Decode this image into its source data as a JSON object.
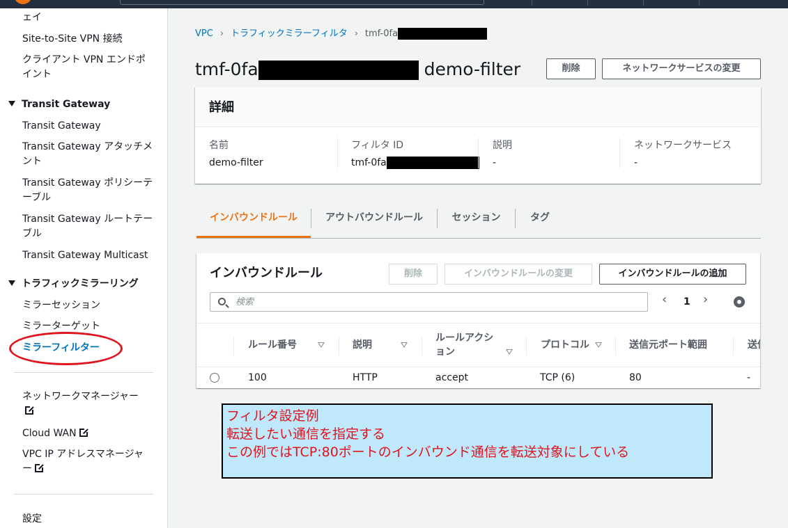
{
  "sidebar": {
    "item_gateway_tail": "ェイ",
    "item_s2s_vpn": "Site-to-Site VPN 接続",
    "item_client_vpn_line1": "クライアント VPN エンドポ",
    "item_client_vpn_line2": "イント",
    "section_tgw": "Transit Gateway",
    "item_tgw": "Transit Gateway",
    "item_tgw_attach_line1": "Transit Gateway アタッチメ",
    "item_tgw_attach_line2": "ント",
    "item_tgw_policy_line1": "Transit Gateway ポリシーテ",
    "item_tgw_policy_line2": "ーブル",
    "item_tgw_route_line1": "Transit Gateway ルートテー",
    "item_tgw_route_line2": "ブル",
    "item_tgw_multicast": "Transit Gateway Multicast",
    "section_mirror": "トラフィックミラーリング",
    "item_mirror_session": "ミラーセッション",
    "item_mirror_target": "ミラーターゲット",
    "item_mirror_filter": "ミラーフィルター",
    "item_network_manager_line1": "ネットワークマネージャー",
    "item_cloud_wan": "Cloud WAN",
    "item_ipam_line1": "VPC IP アドレスマネージャ",
    "item_ipam_line2": "ー",
    "item_settings": "設定",
    "external_icon": "external-link-icon"
  },
  "breadcrumb": {
    "vpc": "VPC",
    "filters": "トラフィックミラーフィルタ",
    "current_prefix": "tmf-0fa"
  },
  "header": {
    "title_prefix": "tmf-0fa",
    "title_suffix": "demo-filter",
    "delete_label": "削除",
    "change_services_label": "ネットワークサービスの変更"
  },
  "details": {
    "heading": "詳細",
    "name_label": "名前",
    "name_value": "demo-filter",
    "filter_id_label": "フィルタ ID",
    "filter_id_prefix": "tmf-0fa",
    "description_label": "説明",
    "description_value": "-",
    "network_services_label": "ネットワークサービス",
    "network_services_value": "-"
  },
  "tabs": [
    "インバウンドルール",
    "アウトバウンドルール",
    "セッション",
    "タグ"
  ],
  "rules": {
    "heading": "インバウンドルール",
    "delete_label": "削除",
    "edit_label": "インバウンドルールの変更",
    "add_label": "インバウンドルールの追加",
    "search_placeholder": "検索",
    "page": "1",
    "columns": {
      "rule_number": "ルール番号",
      "description": "説明",
      "action_line1": "ルールアクシ",
      "action_line2": "ョン",
      "protocol": "プロトコル",
      "source_port": "送信元ポート範囲",
      "dest_partial": "送信"
    },
    "rows": [
      {
        "rule_number": "100",
        "description": "HTTP",
        "action": "accept",
        "protocol": "TCP (6)",
        "source_port": "80",
        "dest": "-"
      }
    ]
  },
  "annotation": {
    "line1": "フィルタ設定例",
    "line2": "転送したい通信を指定する",
    "line3": "この例ではTCP:80ポートのインバウンド通信を転送対象にしている"
  },
  "colors": {
    "accent_orange": "#ec7211",
    "link_blue": "#0073bb",
    "annotation_red": "#e0141e",
    "annotation_bg": "#bfe9fb"
  }
}
